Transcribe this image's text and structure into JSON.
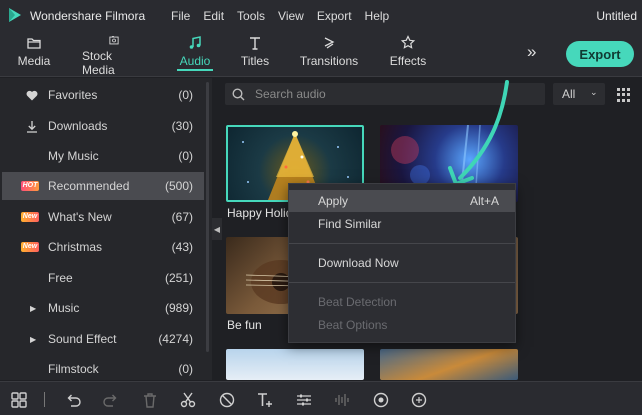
{
  "app": {
    "name": "Wondershare Filmora",
    "document_title": "Untitled",
    "menu": [
      "File",
      "Edit",
      "Tools",
      "View",
      "Export",
      "Help"
    ]
  },
  "toolbar": {
    "tabs": [
      {
        "label": "Media",
        "icon": "folder-icon"
      },
      {
        "label": "Stock Media",
        "icon": "image-icon"
      },
      {
        "label": "Audio",
        "icon": "music-note-icon",
        "active": true
      },
      {
        "label": "Titles",
        "icon": "text-icon"
      },
      {
        "label": "Transitions",
        "icon": "transition-icon"
      },
      {
        "label": "Effects",
        "icon": "effects-icon"
      }
    ],
    "more": "»",
    "export_label": "Export"
  },
  "sidebar": {
    "items": [
      {
        "label": "Favorites",
        "count": "(0)",
        "icon": "heart-icon"
      },
      {
        "label": "Downloads",
        "count": "(30)",
        "icon": "download-icon"
      },
      {
        "label": "My Music",
        "count": "(0)"
      },
      {
        "label": "Recommended",
        "count": "(500)",
        "badge": "HOT",
        "selected": true
      },
      {
        "label": "What's New",
        "count": "(67)",
        "badge": "New"
      },
      {
        "label": "Christmas",
        "count": "(43)",
        "badge": "New"
      },
      {
        "label": "Free",
        "count": "(251)"
      },
      {
        "label": "Music",
        "count": "(989)",
        "expandable": true
      },
      {
        "label": "Sound Effect",
        "count": "(4274)",
        "expandable": true
      },
      {
        "label": "Filmstock",
        "count": "(0)"
      }
    ]
  },
  "search": {
    "placeholder": "Search audio",
    "filter_value": "All"
  },
  "thumbnails": [
    {
      "label": "Happy Holid"
    },
    {
      "label": ""
    },
    {
      "label": "Be fun"
    }
  ],
  "context_menu": {
    "items": [
      {
        "label": "Apply",
        "shortcut": "Alt+A"
      },
      {
        "label": "Find Similar"
      },
      {
        "label": "Download Now"
      },
      {
        "label": "Beat Detection",
        "disabled": true
      },
      {
        "label": "Beat Options",
        "disabled": true
      }
    ]
  },
  "colors": {
    "accent": "#46d8bb",
    "background": "#1f2024",
    "panel": "#2a2b30"
  }
}
